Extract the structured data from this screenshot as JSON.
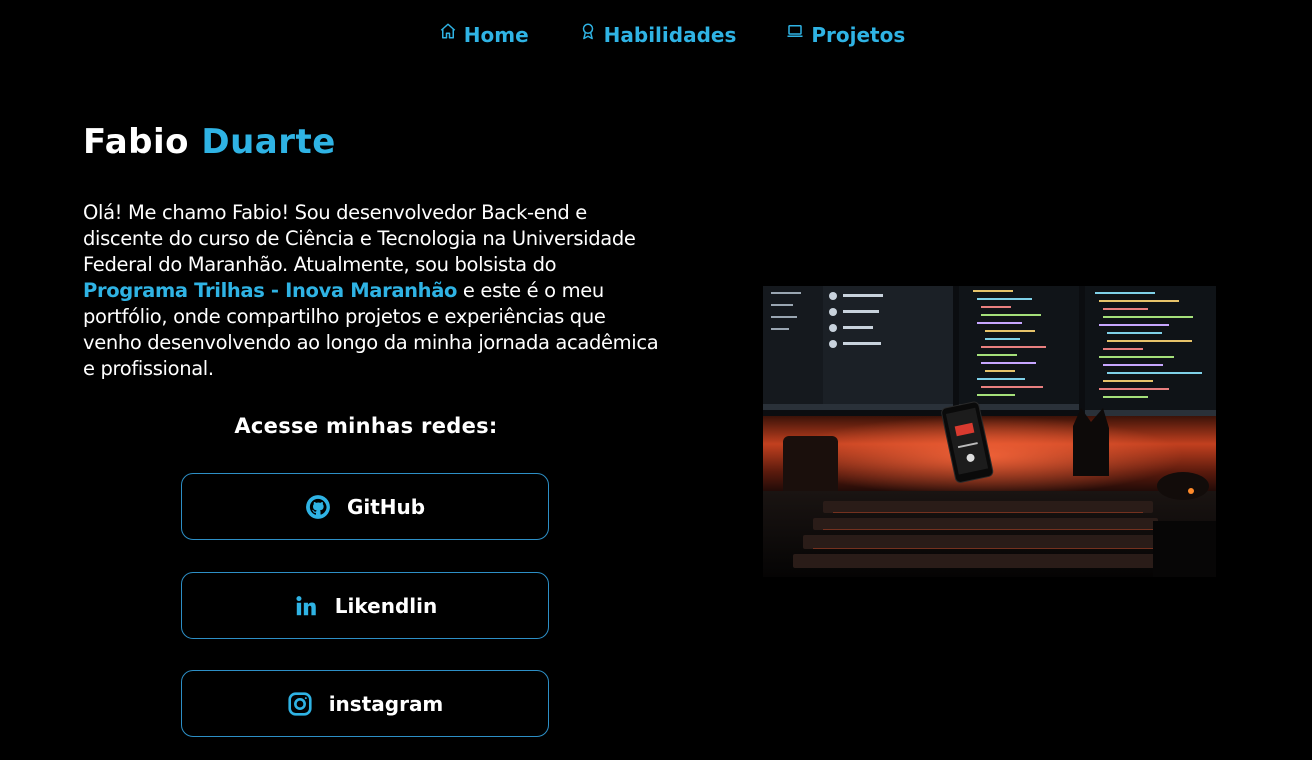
{
  "nav": {
    "items": [
      {
        "label": "Home",
        "icon": "home-icon"
      },
      {
        "label": "Habilidades",
        "icon": "award-icon"
      },
      {
        "label": "Projetos",
        "icon": "laptop-icon"
      }
    ]
  },
  "hero": {
    "first_name": "Fabio",
    "last_name": "Duarte",
    "intro_before": "Olá! Me chamo Fabio! Sou desenvolvedor Back-end e discente do curso de Ciência e Tecnologia na Universidade Federal do Maranhão. Atualmente, sou bolsista do ",
    "intro_highlight": "Programa Trilhas - Inova Maranhão",
    "intro_after": " e este é o meu portfólio, onde compartilho projetos e experiências que venho desenvolvendo ao longo da minha jornada acadêmica e profissional."
  },
  "social": {
    "heading": "Acesse minhas redes:",
    "buttons": [
      {
        "label": "GitHub",
        "icon": "github-icon"
      },
      {
        "label": "Likendlin",
        "icon": "linkedin-icon"
      },
      {
        "label": "instagram",
        "icon": "instagram-icon"
      }
    ]
  },
  "colors": {
    "background": "#000000",
    "accent": "#2fb3e4",
    "text": "#ffffff",
    "button_border": "#2d8fc6"
  }
}
